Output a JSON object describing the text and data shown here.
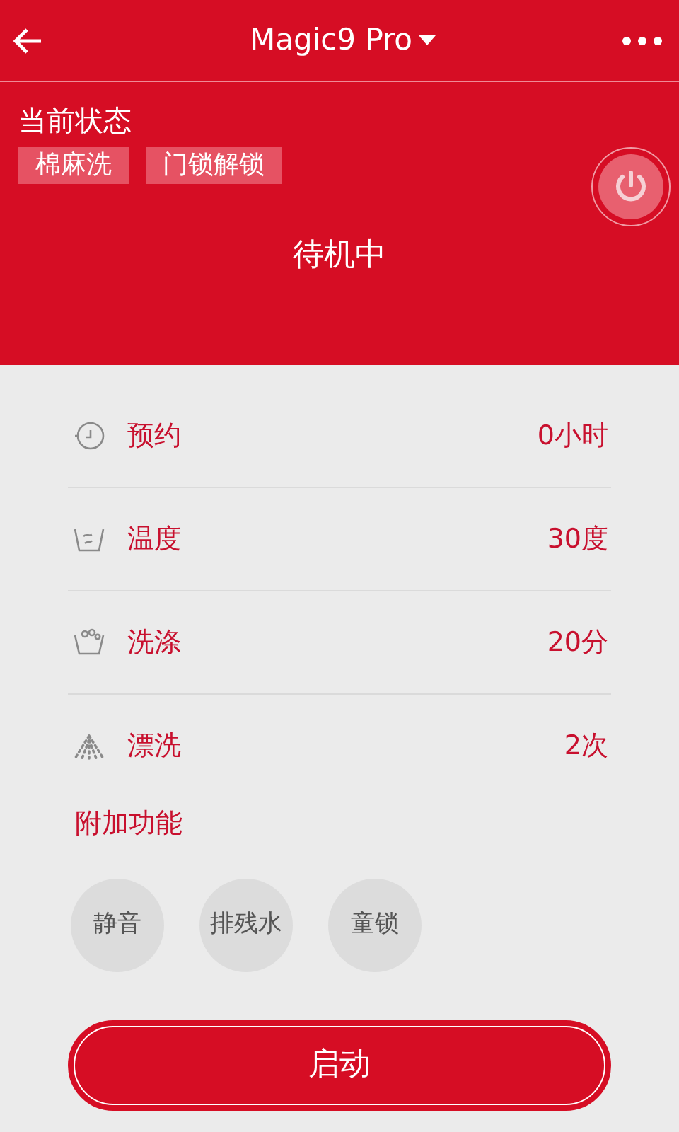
{
  "header": {
    "title": "Magic9 Pro",
    "status_label": "当前状态",
    "tags": [
      "棉麻洗",
      "门锁解锁"
    ],
    "state": "待机中"
  },
  "settings": [
    {
      "label": "预约",
      "value": "0小时"
    },
    {
      "label": "温度",
      "value": "30度"
    },
    {
      "label": "洗涤",
      "value": "20分"
    },
    {
      "label": "漂洗",
      "value": "2次"
    }
  ],
  "extras": {
    "title": "附加功能",
    "options": [
      {
        "label": "静音",
        "selected": false
      },
      {
        "label": "排残水",
        "selected": false
      },
      {
        "label": "童锁",
        "selected": false
      }
    ]
  },
  "start_button": "启动"
}
